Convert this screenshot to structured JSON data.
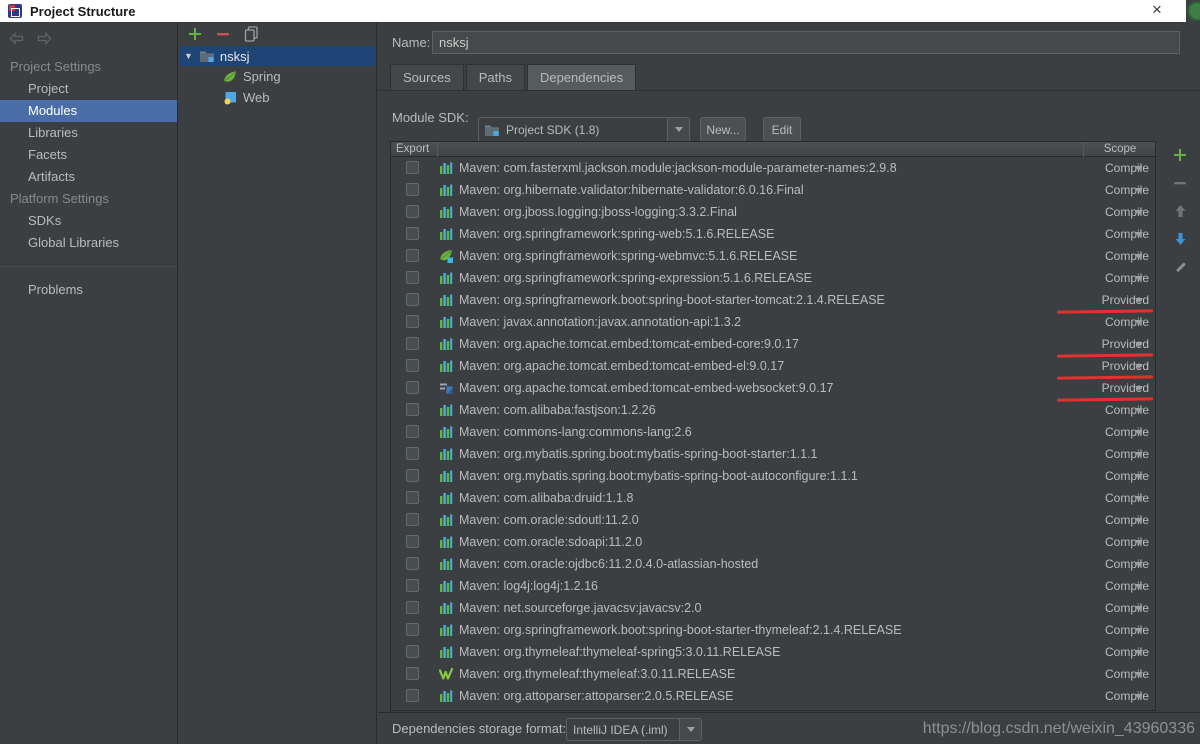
{
  "window": {
    "title": "Project Structure",
    "close_glyph": "×"
  },
  "sidebar": {
    "selected": "Modules",
    "groups": [
      {
        "label": "Project Settings",
        "items": [
          "Project",
          "Modules",
          "Libraries",
          "Facets",
          "Artifacts"
        ]
      },
      {
        "label": "Platform Settings",
        "items": [
          "SDKs",
          "Global Libraries"
        ]
      }
    ],
    "problems_label": "Problems"
  },
  "tree": {
    "root": {
      "label": "nsksj",
      "icon": "module-icon"
    },
    "children": [
      {
        "label": "Spring",
        "icon": "spring-leaf-icon"
      },
      {
        "label": "Web",
        "icon": "web-facet-icon"
      }
    ]
  },
  "form": {
    "name_label": "Name:",
    "name_value": "nsksj",
    "tabs": [
      "Sources",
      "Paths",
      "Dependencies"
    ],
    "active_tab": "Dependencies",
    "sdk_label": "Module SDK:",
    "sdk_value": "Project SDK (1.8)",
    "new_button": "New...",
    "edit_button": "Edit"
  },
  "table": {
    "export_header": "Export",
    "scope_header": "Scope",
    "rows": [
      {
        "label": "Maven: com.fasterxml.jackson.module:jackson-module-parameter-names:2.9.8",
        "scope": "Compile",
        "icon": "library-icon",
        "marked": false
      },
      {
        "label": "Maven: org.hibernate.validator:hibernate-validator:6.0.16.Final",
        "scope": "Compile",
        "icon": "library-icon",
        "marked": false
      },
      {
        "label": "Maven: org.jboss.logging:jboss-logging:3.3.2.Final",
        "scope": "Compile",
        "icon": "library-icon",
        "marked": false
      },
      {
        "label": "Maven: org.springframework:spring-web:5.1.6.RELEASE",
        "scope": "Compile",
        "icon": "library-icon",
        "marked": false
      },
      {
        "label": "Maven: org.springframework:spring-webmvc:5.1.6.RELEASE",
        "scope": "Compile",
        "icon": "spring-webmvc-icon",
        "marked": false
      },
      {
        "label": "Maven: org.springframework:spring-expression:5.1.6.RELEASE",
        "scope": "Compile",
        "icon": "library-icon",
        "marked": false
      },
      {
        "label": "Maven: org.springframework.boot:spring-boot-starter-tomcat:2.1.4.RELEASE",
        "scope": "Provided",
        "icon": "library-icon",
        "marked": true
      },
      {
        "label": "Maven: javax.annotation:javax.annotation-api:1.3.2",
        "scope": "Compile",
        "icon": "library-icon",
        "marked": false
      },
      {
        "label": "Maven: org.apache.tomcat.embed:tomcat-embed-core:9.0.17",
        "scope": "Provided",
        "icon": "library-icon",
        "marked": true
      },
      {
        "label": "Maven: org.apache.tomcat.embed:tomcat-embed-el:9.0.17",
        "scope": "Provided",
        "icon": "library-icon",
        "marked": true
      },
      {
        "label": "Maven: org.apache.tomcat.embed:tomcat-embed-websocket:9.0.17",
        "scope": "Provided",
        "icon": "websocket-icon",
        "marked": true
      },
      {
        "label": "Maven: com.alibaba:fastjson:1.2.26",
        "scope": "Compile",
        "icon": "library-icon",
        "marked": false
      },
      {
        "label": "Maven: commons-lang:commons-lang:2.6",
        "scope": "Compile",
        "icon": "library-icon",
        "marked": false
      },
      {
        "label": "Maven: org.mybatis.spring.boot:mybatis-spring-boot-starter:1.1.1",
        "scope": "Compile",
        "icon": "library-icon",
        "marked": false
      },
      {
        "label": "Maven: org.mybatis.spring.boot:mybatis-spring-boot-autoconfigure:1.1.1",
        "scope": "Compile",
        "icon": "library-icon",
        "marked": false
      },
      {
        "label": "Maven: com.alibaba:druid:1.1.8",
        "scope": "Compile",
        "icon": "library-icon",
        "marked": false
      },
      {
        "label": "Maven: com.oracle:sdoutl:11.2.0",
        "scope": "Compile",
        "icon": "library-icon",
        "marked": false
      },
      {
        "label": "Maven: com.oracle:sdoapi:11.2.0",
        "scope": "Compile",
        "icon": "library-icon",
        "marked": false
      },
      {
        "label": "Maven: com.oracle:ojdbc6:11.2.0.4.0-atlassian-hosted",
        "scope": "Compile",
        "icon": "library-icon",
        "marked": false
      },
      {
        "label": "Maven: log4j:log4j:1.2.16",
        "scope": "Compile",
        "icon": "library-icon",
        "marked": false
      },
      {
        "label": "Maven: net.sourceforge.javacsv:javacsv:2.0",
        "scope": "Compile",
        "icon": "library-icon",
        "marked": false
      },
      {
        "label": "Maven: org.springframework.boot:spring-boot-starter-thymeleaf:2.1.4.RELEASE",
        "scope": "Compile",
        "icon": "library-icon",
        "marked": false
      },
      {
        "label": "Maven: org.thymeleaf:thymeleaf-spring5:3.0.11.RELEASE",
        "scope": "Compile",
        "icon": "library-icon",
        "marked": false
      },
      {
        "label": "Maven: org.thymeleaf:thymeleaf:3.0.11.RELEASE",
        "scope": "Compile",
        "icon": "thymeleaf-icon",
        "marked": false
      },
      {
        "label": "Maven: org.attoparser:attoparser:2.0.5.RELEASE",
        "scope": "Compile",
        "icon": "library-icon",
        "marked": false
      },
      {
        "label": "",
        "scope": "",
        "icon": "library-icon",
        "marked": false,
        "partial": true
      }
    ]
  },
  "footer": {
    "label": "Dependencies storage format:",
    "value": "IntelliJ IDEA (.iml)"
  },
  "watermark": "https://blog.csdn.net/weixin_43960336",
  "colors": {
    "sidebar_selection": "#4A6DA7",
    "tree_selection": "#1F4576",
    "red_annotation": "#E3312D",
    "add_green": "#62B543",
    "move_down_blue": "#3B92D6",
    "library_bar_green": "#62B543",
    "library_bar_blue": "#40B6E0"
  }
}
